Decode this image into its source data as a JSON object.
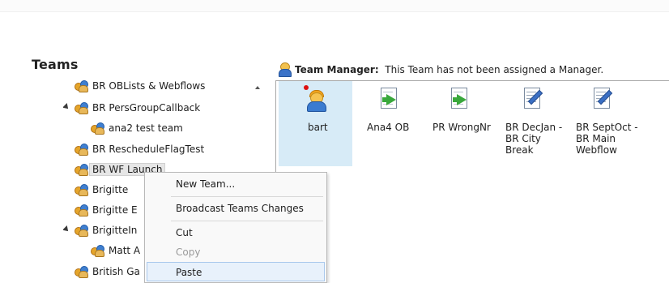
{
  "teams_panel": {
    "title": "Teams",
    "tree": [
      {
        "label": "BR OBLists & Webflows",
        "indent": 1,
        "expander": "",
        "icon": "team-icon"
      },
      {
        "label": "BR PersGroupCallback",
        "indent": 1,
        "expander": "expanded",
        "icon": "team-icon"
      },
      {
        "label": "ana2 test team",
        "indent": 2,
        "expander": "",
        "icon": "team-icon"
      },
      {
        "label": "BR RescheduleFlagTest",
        "indent": 1,
        "expander": "",
        "icon": "team-icon"
      },
      {
        "label": "BR WF Launch",
        "indent": 1,
        "expander": "",
        "icon": "team-icon",
        "selected": true
      },
      {
        "label": "Brigitte",
        "indent": 1,
        "expander": "",
        "icon": "team-icon"
      },
      {
        "label": "Brigitte E",
        "indent": 1,
        "expander": "",
        "icon": "team-icon"
      },
      {
        "label": "BrigitteIn",
        "indent": 1,
        "expander": "expanded",
        "icon": "team-icon"
      },
      {
        "label": "Matt A",
        "indent": 2,
        "expander": "",
        "icon": "team-icon"
      },
      {
        "label": "British Ga",
        "indent": 1,
        "expander": "",
        "icon": "team-icon"
      }
    ]
  },
  "context_menu": {
    "items": [
      {
        "label": "New Team...",
        "disabled": false,
        "hover": false
      },
      {
        "label": "Broadcast Teams Changes",
        "disabled": false,
        "hover": false
      },
      {
        "label": "Cut",
        "disabled": false,
        "hover": false
      },
      {
        "label": "Copy",
        "disabled": true,
        "hover": false
      },
      {
        "label": "Paste",
        "disabled": false,
        "hover": true
      }
    ]
  },
  "team_manager": {
    "label": "Team Manager:",
    "text": "This Team has not been assigned a Manager."
  },
  "members": [
    {
      "label": "bart",
      "icon": "agent-icon",
      "selected": true
    },
    {
      "label": "Ana4 OB",
      "icon": "document-arrow-icon",
      "selected": false
    },
    {
      "label": "PR WrongNr",
      "icon": "document-arrow-icon",
      "selected": false
    },
    {
      "label": "BR DecJan -\nBR City\nBreak",
      "icon": "document-pencil-icon",
      "selected": false
    },
    {
      "label": "BR SeptOct -\nBR Main\nWebflow",
      "icon": "document-pencil-icon",
      "selected": false
    }
  ],
  "colors": {
    "selection": "#d7ebf7",
    "menu_hover": "#e8f1fb",
    "tree_selection": "#e6e6e6"
  }
}
